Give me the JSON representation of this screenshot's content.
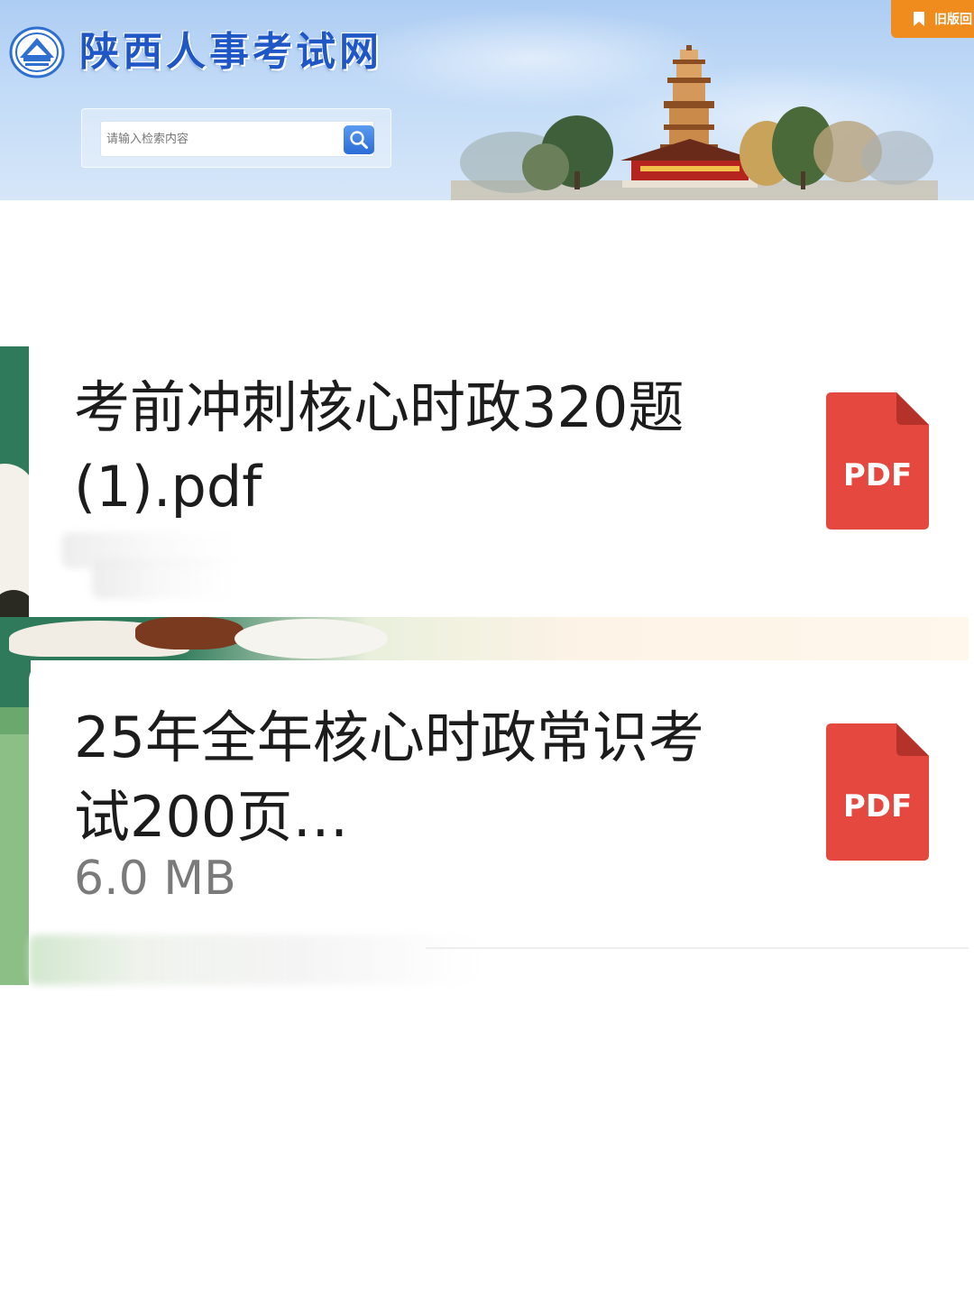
{
  "header": {
    "site_title": "陕西人事考试网",
    "search_placeholder": "请输入检索内容",
    "old_version_label": "旧版回",
    "colors": {
      "title_blue": "#1f57c6",
      "old_version_orange": "#f08c1e"
    }
  },
  "files": [
    {
      "name": "考前冲刺核心时政320题(1).pdf",
      "size": "",
      "type_label": "PDF",
      "icon": "pdf-file-icon"
    },
    {
      "name": "25年全年核心时政常识考试200页…",
      "size": "6.0 MB",
      "type_label": "PDF",
      "icon": "pdf-file-icon"
    }
  ],
  "colors": {
    "pdf_red": "#e5483f"
  }
}
